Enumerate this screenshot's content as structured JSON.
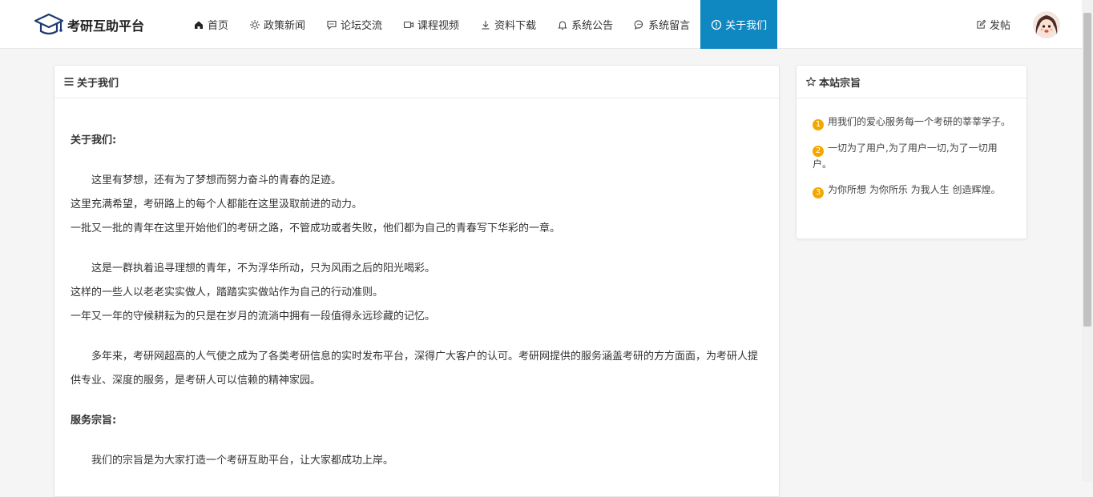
{
  "brand": {
    "name": "考研互助平台"
  },
  "nav": {
    "items": [
      {
        "label": "首页",
        "icon": "home-icon"
      },
      {
        "label": "政策新闻",
        "icon": "sun-icon"
      },
      {
        "label": "论坛交流",
        "icon": "message-icon"
      },
      {
        "label": "课程视频",
        "icon": "video-icon"
      },
      {
        "label": "资料下载",
        "icon": "download-icon"
      },
      {
        "label": "系统公告",
        "icon": "bell-icon"
      },
      {
        "label": "系统留言",
        "icon": "chat-icon"
      },
      {
        "label": "关于我们",
        "icon": "info-circle-icon",
        "active": true
      }
    ],
    "post_label": "发帖",
    "active_color": "#0f87c1"
  },
  "main": {
    "title": "关于我们",
    "heading1": "关于我们:",
    "para1": [
      "这里有梦想，还有为了梦想而努力奋斗的青春的足迹。",
      "这里充满希望，考研路上的每个人都能在这里汲取前进的动力。",
      "一批又一批的青年在这里开始他们的考研之路，不管成功或者失败，他们都为自己的青春写下华彩的一章。"
    ],
    "para2": [
      "这是一群执着追寻理想的青年，不为浮华所动，只为风雨之后的阳光喝彩。",
      "这样的一些人以老老实实做人，踏踏实实做站作为自己的行动准则。",
      "一年又一年的守候耕耘为的只是在岁月的流淌中拥有一段值得永远珍藏的记忆。"
    ],
    "para3": "多年来，考研网超高的人气使之成为了各类考研信息的实时发布平台，深得广大客户的认可。考研网提供的服务涵盖考研的方方面面，为考研人提供专业、深度的服务，是考研人可以信赖的精神家园。",
    "heading2": "服务宗旨:",
    "para4": "我们的宗旨是为大家打造一个考研互助平台，让大家都成功上岸。"
  },
  "side": {
    "title": "本站宗旨",
    "items": [
      {
        "num": "1",
        "text": "用我们的爱心服务每一个考研的莘莘学子。"
      },
      {
        "num": "2",
        "text": "一切为了用户,为了用户一切,为了一切用户。"
      },
      {
        "num": "3",
        "text": "为你所想 为你所乐 为我人生 创造辉煌。"
      }
    ],
    "badge_color": "#f5a700"
  }
}
